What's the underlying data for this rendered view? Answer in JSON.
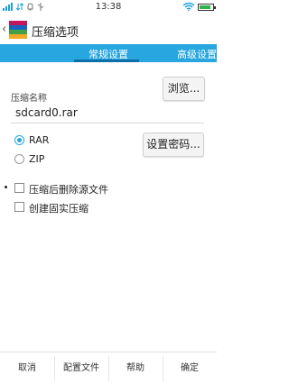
{
  "status_bar": {
    "time": "13:38"
  },
  "app_bar": {
    "back": "‹",
    "title": "压缩选项"
  },
  "tabs": [
    {
      "label": "常规设置",
      "active": true
    },
    {
      "label": "高级设置",
      "active": false
    }
  ],
  "form": {
    "archive_name_label": "压缩名称",
    "archive_name_value": "sdcard0.rar",
    "browse_button": "浏览...",
    "set_password_button": "设置密码...",
    "formats": [
      {
        "label": "RAR",
        "selected": true
      },
      {
        "label": "ZIP",
        "selected": false
      }
    ],
    "options": [
      {
        "label": "压缩后删除源文件",
        "checked": false
      },
      {
        "label": "创建固实压缩",
        "checked": false
      }
    ]
  },
  "bottom_bar": {
    "cancel": "取消",
    "profile": "配置文件",
    "help": "帮助",
    "ok": "确定"
  },
  "colors": {
    "accent": "#27a6df",
    "tab_indicator": "#0b6fa8"
  }
}
